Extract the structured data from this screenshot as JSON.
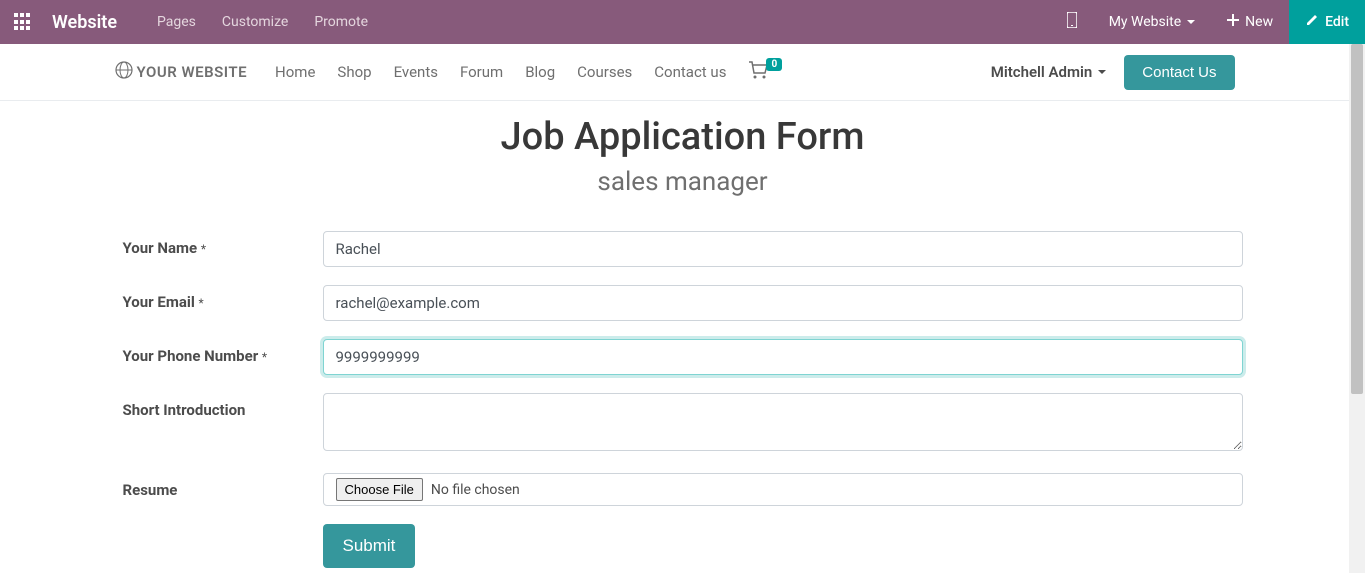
{
  "topbar": {
    "brand": "Website",
    "menu": [
      "Pages",
      "Customize",
      "Promote"
    ],
    "my_website": "My Website",
    "new": "New",
    "edit": "Edit"
  },
  "sitebar": {
    "logo_text": "YOUR WEBSITE",
    "nav": [
      "Home",
      "Shop",
      "Events",
      "Forum",
      "Blog",
      "Courses",
      "Contact us"
    ],
    "cart_count": "0",
    "user": "Mitchell Admin",
    "contact_btn": "Contact Us"
  },
  "page": {
    "title": "Job Application Form",
    "subtitle": "sales manager"
  },
  "form": {
    "name_label": "Your Name",
    "name_value": "Rachel",
    "email_label": "Your Email",
    "email_value": "rachel@example.com",
    "phone_label": "Your Phone Number",
    "phone_value": "9999999999",
    "intro_label": "Short Introduction",
    "intro_value": "",
    "resume_label": "Resume",
    "file_btn": "Choose File",
    "file_text": "No file chosen",
    "submit": "Submit",
    "required_mark": "*"
  }
}
